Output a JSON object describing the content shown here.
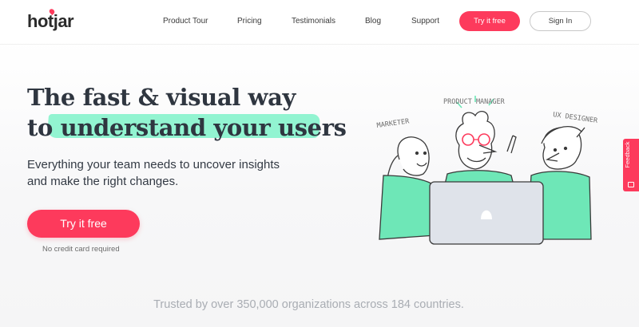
{
  "header": {
    "logo": "hotjar",
    "nav": [
      {
        "label": "Product Tour"
      },
      {
        "label": "Pricing"
      },
      {
        "label": "Testimonials"
      },
      {
        "label": "Blog"
      },
      {
        "label": "Support"
      }
    ],
    "try_button": "Try it free",
    "signin_button": "Sign In"
  },
  "hero": {
    "headline_line1": "The fast & visual way",
    "headline_to": "to ",
    "headline_highlight": "understand your users",
    "subtext": "Everything your team needs to uncover insights and make the right changes.",
    "cta": "Try it free",
    "cta_note": "No credit card required"
  },
  "illustration": {
    "labels": {
      "product_manager": "PRODUCT MANAGER",
      "marketer": "MARKETER",
      "ux_designer": "UX DESIGNER"
    }
  },
  "trusted": "Trusted by over 350,000 organizations across 184 countries.",
  "feedback_tab": "Feedback",
  "colors": {
    "brand": "#fd3a5c",
    "highlight": "#7ff2c9",
    "shirt": "#6ee7b7",
    "laptop": "#dfe3ea"
  }
}
